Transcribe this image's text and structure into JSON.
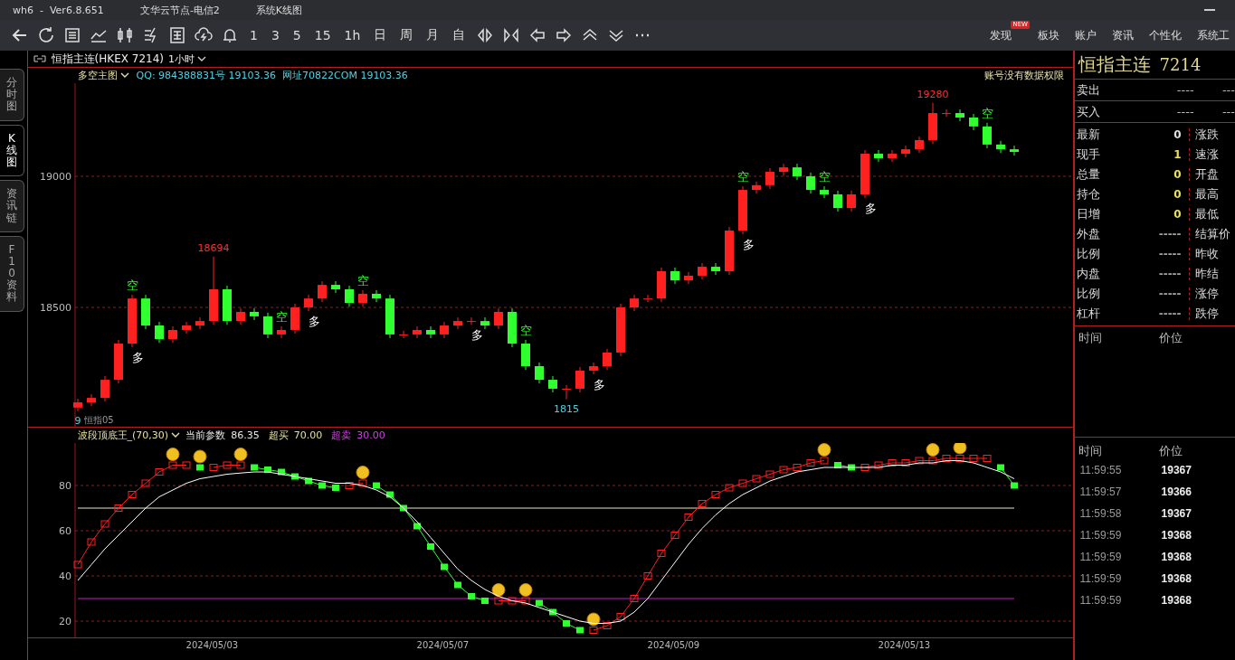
{
  "window": {
    "title_parts": [
      "wh6  -  Ver6.8.651",
      "文华云节点-电信2",
      "系统K线图"
    ]
  },
  "toolbar": {
    "periods": [
      "1",
      "3",
      "5",
      "15",
      "1h",
      "日",
      "周",
      "月",
      "自"
    ],
    "nav": [
      {
        "label": "发现",
        "badge": "NEW"
      },
      {
        "label": "板块"
      },
      {
        "label": "账户"
      },
      {
        "label": "资讯"
      },
      {
        "label": "个性化"
      },
      {
        "label": "系统工"
      }
    ]
  },
  "symbol_bar": {
    "symbol": "恒指主连(HKEX 7214)",
    "period": "1小时"
  },
  "side_tabs": [
    {
      "label": "分时图",
      "selected": false
    },
    {
      "label": "K线图",
      "selected": true
    },
    {
      "label": "资讯链",
      "selected": false
    },
    {
      "label": "F10资料",
      "selected": false
    }
  ],
  "main_chart": {
    "indicator": "多空主图",
    "info": "QQ: 984388831号 19103.36  网址70822COM 19103.36",
    "notice": "账号没有数据权限",
    "legend": "恒指05",
    "marks": [
      {
        "text": "空",
        "kind": "short"
      },
      {
        "text": "空",
        "kind": "short"
      },
      {
        "text": "空",
        "kind": "short"
      },
      {
        "text": "空",
        "kind": "short"
      },
      {
        "text": "空",
        "kind": "short"
      },
      {
        "text": "空",
        "kind": "short"
      },
      {
        "text": "空",
        "kind": "short"
      },
      {
        "text": "多",
        "kind": "long"
      },
      {
        "text": "多",
        "kind": "long"
      },
      {
        "text": "多",
        "kind": "long"
      },
      {
        "text": "多",
        "kind": "long"
      },
      {
        "text": "多",
        "kind": "long"
      },
      {
        "text": "多",
        "kind": "long"
      },
      {
        "text": "18694",
        "kind": "high"
      },
      {
        "text": "19280",
        "kind": "high"
      },
      {
        "text": "1815",
        "kind": "low"
      },
      {
        "text": "9",
        "kind": "low"
      }
    ],
    "chart_data": {
      "type": "candlestick",
      "ylim": [
        18045,
        19355
      ],
      "yticks": [
        18500,
        19000
      ],
      "grid": true,
      "ohlc": [
        [
          18118,
          18152,
          18104,
          18138
        ],
        [
          18138,
          18169,
          18124,
          18155
        ],
        [
          18155,
          18238,
          18141,
          18224
        ],
        [
          18224,
          18376,
          18210,
          18362
        ],
        [
          18362,
          18548,
          18348,
          18534
        ],
        [
          18534,
          18548,
          18417,
          18431
        ],
        [
          18431,
          18445,
          18365,
          18379
        ],
        [
          18379,
          18428,
          18365,
          18414
        ],
        [
          18414,
          18445,
          18400,
          18431
        ],
        [
          18431,
          18462,
          18417,
          18448
        ],
        [
          18448,
          18694,
          18434,
          18569
        ],
        [
          18569,
          18583,
          18434,
          18448
        ],
        [
          18448,
          18497,
          18434,
          18483
        ],
        [
          18483,
          18497,
          18452,
          18466
        ],
        [
          18466,
          18480,
          18383,
          18397
        ],
        [
          18397,
          18428,
          18383,
          18414
        ],
        [
          18414,
          18514,
          18400,
          18500
        ],
        [
          18500,
          18548,
          18486,
          18534
        ],
        [
          18534,
          18600,
          18520,
          18586
        ],
        [
          18586,
          18600,
          18555,
          18569
        ],
        [
          18569,
          18583,
          18503,
          18517
        ],
        [
          18517,
          18566,
          18503,
          18552
        ],
        [
          18552,
          18566,
          18520,
          18534
        ],
        [
          18534,
          18548,
          18383,
          18397
        ],
        [
          18397,
          18411,
          18383,
          18397
        ],
        [
          18397,
          18428,
          18383,
          18414
        ],
        [
          18414,
          18428,
          18383,
          18397
        ],
        [
          18397,
          18445,
          18383,
          18431
        ],
        [
          18431,
          18462,
          18417,
          18448
        ],
        [
          18448,
          18462,
          18434,
          18448
        ],
        [
          18448,
          18462,
          18417,
          18431
        ],
        [
          18431,
          18497,
          18417,
          18483
        ],
        [
          18483,
          18497,
          18348,
          18362
        ],
        [
          18362,
          18376,
          18262,
          18276
        ],
        [
          18276,
          18290,
          18210,
          18224
        ],
        [
          18224,
          18238,
          18176,
          18190
        ],
        [
          18190,
          18204,
          18150,
          18190
        ],
        [
          18190,
          18273,
          18176,
          18259
        ],
        [
          18259,
          18290,
          18245,
          18276
        ],
        [
          18276,
          18342,
          18262,
          18328
        ],
        [
          18328,
          18514,
          18314,
          18500
        ],
        [
          18500,
          18548,
          18486,
          18534
        ],
        [
          18534,
          18548,
          18520,
          18534
        ],
        [
          18534,
          18652,
          18520,
          18638
        ],
        [
          18638,
          18652,
          18589,
          18603
        ],
        [
          18603,
          18635,
          18589,
          18621
        ],
        [
          18621,
          18669,
          18607,
          18655
        ],
        [
          18655,
          18669,
          18624,
          18638
        ],
        [
          18638,
          18807,
          18624,
          18793
        ],
        [
          18793,
          18962,
          18779,
          18948
        ],
        [
          18948,
          18980,
          18934,
          18966
        ],
        [
          18966,
          19031,
          18952,
          19017
        ],
        [
          19017,
          19048,
          19003,
          19034
        ],
        [
          19034,
          19048,
          18986,
          19000
        ],
        [
          19000,
          19014,
          18934,
          18948
        ],
        [
          18948,
          18962,
          18917,
          18931
        ],
        [
          18931,
          18945,
          18865,
          18879
        ],
        [
          18879,
          18945,
          18865,
          18931
        ],
        [
          18931,
          19100,
          18917,
          19086
        ],
        [
          19086,
          19100,
          19055,
          19069
        ],
        [
          19069,
          19100,
          19055,
          19086
        ],
        [
          19086,
          19117,
          19072,
          19103
        ],
        [
          19103,
          19152,
          19089,
          19138
        ],
        [
          19138,
          19280,
          19124,
          19241
        ],
        [
          19241,
          19255,
          19227,
          19241
        ],
        [
          19241,
          19255,
          19210,
          19224
        ],
        [
          19224,
          19238,
          19176,
          19190
        ],
        [
          19190,
          19204,
          19107,
          19121
        ],
        [
          19121,
          19135,
          19089,
          19103
        ],
        [
          19103,
          19117,
          19079,
          19093
        ]
      ]
    }
  },
  "indicator_chart": {
    "name": "波段顶底王_(70,30)",
    "params": [
      {
        "label": "当前参数",
        "value": "86.35",
        "color": "#e8e8e8"
      },
      {
        "label": "超买",
        "value": "70.00",
        "color": "#e0e0a0"
      },
      {
        "label": "超卖",
        "value": "30.00",
        "color": "#d040e0"
      }
    ],
    "date_labels": [
      "2024/05/03",
      "2024/05/07",
      "2024/05/09",
      "2024/05/13"
    ],
    "chart_data": {
      "type": "line",
      "ylim": [
        12.8,
        98.8
      ],
      "yticks": [
        20,
        40,
        60,
        80
      ],
      "grid": true,
      "series": [
        {
          "color": "#ff2020",
          "marker": "square",
          "values": [
            45,
            55,
            63,
            70,
            76,
            81,
            86,
            89,
            89,
            null,
            88,
            89,
            89,
            null,
            null,
            null,
            null,
            null,
            null,
            null,
            80,
            81,
            null,
            null,
            null,
            null,
            null,
            null,
            null,
            null,
            null,
            29,
            29,
            29,
            null,
            null,
            null,
            null,
            16,
            18,
            22,
            30,
            40,
            50,
            58,
            66,
            72,
            76,
            79,
            81,
            83,
            85,
            87,
            88,
            90,
            91,
            null,
            null,
            88,
            89,
            90,
            90,
            91,
            91,
            92,
            92,
            92,
            92,
            null,
            null
          ]
        },
        {
          "color": "#30ff30",
          "marker": "square",
          "values": [
            null,
            null,
            null,
            null,
            null,
            null,
            null,
            null,
            null,
            88,
            null,
            null,
            null,
            88,
            87,
            86,
            84,
            82,
            80,
            79,
            null,
            null,
            80,
            76,
            70,
            62,
            53,
            44,
            36,
            31,
            29,
            null,
            null,
            null,
            28,
            24,
            19,
            16,
            null,
            null,
            null,
            null,
            null,
            null,
            null,
            null,
            null,
            null,
            null,
            null,
            null,
            null,
            null,
            null,
            null,
            null,
            89,
            88,
            null,
            null,
            null,
            null,
            null,
            null,
            null,
            null,
            null,
            null,
            88,
            80
          ]
        },
        {
          "color": "#ffffff",
          "values": [
            38,
            45,
            52,
            58,
            64,
            70,
            75,
            78,
            81,
            83,
            84,
            85,
            85.5,
            86,
            86,
            85,
            84,
            83,
            82,
            81,
            81,
            80,
            78,
            75,
            70,
            64,
            57,
            50,
            43,
            38,
            34,
            31,
            29,
            28,
            26,
            24,
            22,
            20,
            19,
            19,
            20,
            24,
            30,
            38,
            46,
            54,
            61,
            67,
            72,
            76,
            79,
            82,
            84,
            86,
            87,
            88,
            88,
            88,
            88,
            88,
            89,
            89,
            90,
            90,
            91,
            91,
            90,
            88,
            86,
            83
          ]
        },
        {
          "color": "#e8e8c0",
          "values": [
            70,
            70,
            70,
            70,
            70,
            70,
            70,
            70,
            70,
            70,
            70,
            70,
            70,
            70,
            70,
            70,
            70,
            70,
            70,
            70,
            70,
            70,
            70,
            70,
            70,
            70,
            70,
            70,
            70,
            70,
            70,
            70,
            70,
            70,
            70,
            70,
            70,
            70,
            70,
            70,
            70,
            70,
            70,
            70,
            70,
            70,
            70,
            70,
            70,
            70,
            70,
            70,
            70,
            70,
            70,
            70,
            70,
            70,
            70,
            70,
            70,
            70,
            70,
            70,
            70,
            70,
            70,
            70,
            70,
            70
          ]
        },
        {
          "color": "#c020c0",
          "values": [
            30,
            30,
            30,
            30,
            30,
            30,
            30,
            30,
            30,
            30,
            30,
            30,
            30,
            30,
            30,
            30,
            30,
            30,
            30,
            30,
            30,
            30,
            30,
            30,
            30,
            30,
            30,
            30,
            30,
            30,
            30,
            30,
            30,
            30,
            30,
            30,
            30,
            30,
            30,
            30,
            30,
            30,
            30,
            30,
            30,
            30,
            30,
            30,
            30,
            30,
            30,
            30,
            30,
            30,
            30,
            30,
            30,
            30,
            30,
            30,
            30,
            30,
            30,
            30,
            30,
            30,
            30,
            30,
            30,
            30
          ]
        }
      ]
    }
  },
  "quote": {
    "title": "恒指主连",
    "code": "7214",
    "book": [
      {
        "label": "卖出",
        "price": "----",
        "volume": "---"
      },
      {
        "label": "买入",
        "price": "----",
        "volume": "---"
      }
    ],
    "stats": [
      {
        "label": "最新",
        "value": "0",
        "color": "#e0e0e0",
        "right_label": "涨跌"
      },
      {
        "label": "现手",
        "value": "1",
        "color": "#e8e060",
        "right_label": "速涨"
      },
      {
        "label": "总量",
        "value": "0",
        "color": "#e8e060",
        "right_label": "开盘"
      },
      {
        "label": "持仓",
        "value": "0",
        "color": "#e8e060",
        "right_label": "最高"
      },
      {
        "label": "日增",
        "value": "0",
        "color": "#e8e060",
        "right_label": "最低"
      },
      {
        "label": "外盘",
        "value": "-----",
        "color": "#a0a0a0",
        "right_label": "结算价"
      },
      {
        "label": "比例",
        "value": "-----",
        "color": "#a0a0a0",
        "right_label": "昨收"
      },
      {
        "label": "内盘",
        "value": "-----",
        "color": "#a0a0a0",
        "right_label": "昨结"
      },
      {
        "label": "比例",
        "value": "-----",
        "color": "#a0a0a0",
        "right_label": "涨停"
      },
      {
        "label": "杠杆",
        "value": "-----",
        "color": "#a0a0a0",
        "right_label": "跌停"
      }
    ],
    "trades_header": [
      "时间",
      "价位"
    ],
    "ticks_header": [
      "时间",
      "价位"
    ],
    "ticks": [
      {
        "time": "11:59:55",
        "price": "19367"
      },
      {
        "time": "11:59:57",
        "price": "19366"
      },
      {
        "time": "11:59:58",
        "price": "19367"
      },
      {
        "time": "11:59:59",
        "price": "19368"
      },
      {
        "time": "11:59:59",
        "price": "19368"
      },
      {
        "time": "11:59:59",
        "price": "19368"
      },
      {
        "time": "11:59:59",
        "price": "19368"
      }
    ]
  }
}
